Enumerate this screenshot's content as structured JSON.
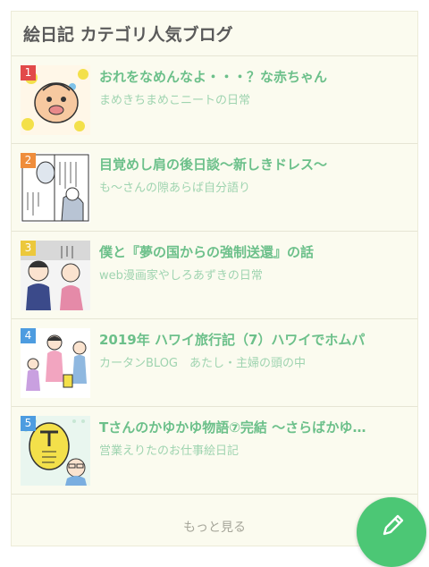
{
  "widget": {
    "title": "絵日記 カテゴリ人気ブログ",
    "more_label": "もっと見る"
  },
  "entries": [
    {
      "rank": "1",
      "title": "おれをなめんなよ・・・？な赤ちゃん",
      "blog": "まめきちまめこニートの日常",
      "rank_color": "#e24a4a",
      "thumb_icon": "baby-comic-thumbnail-icon"
    },
    {
      "rank": "2",
      "title": "目覚めし肩の後日談〜新しきドレス〜",
      "blog": "も〜さんの隙あらば自分語り",
      "rank_color": "#ef8d3b",
      "thumb_icon": "comic-panel-thumbnail-icon"
    },
    {
      "rank": "3",
      "title": "僕と『夢の国からの強制送還』の話",
      "blog": "web漫画家やしろあずきの日常",
      "rank_color": "#ecc83c",
      "thumb_icon": "comic-people-thumbnail-icon"
    },
    {
      "rank": "4",
      "title": "2019年 ハワイ旅行記（7）ハワイでホムパ",
      "blog": "カータンBLOG　あたし・主婦の頭の中",
      "rank_color": "#4d9ce0",
      "thumb_icon": "family-illustration-thumbnail-icon"
    },
    {
      "rank": "5",
      "title": "Tさんのかゆかゆ物語⑦完結 〜さらばかゆ…",
      "blog": "営業えりたのお仕事絵日記",
      "rank_color": "#4d9ce0",
      "thumb_icon": "t-san-comic-thumbnail-icon"
    }
  ],
  "fab": {
    "icon": "pencil-icon",
    "color": "#4cc775"
  }
}
